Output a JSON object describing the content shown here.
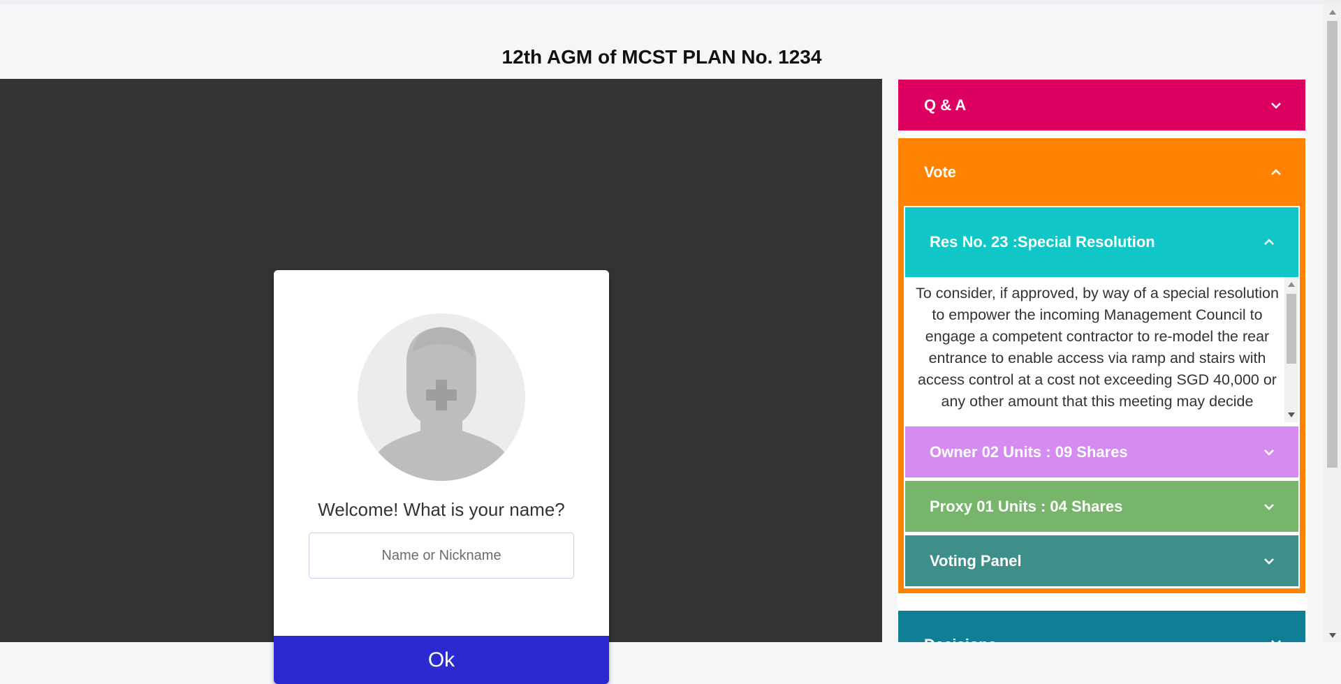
{
  "header": {
    "title": "12th AGM of MCST PLAN No. 1234"
  },
  "login_modal": {
    "welcome": "Welcome! What is your name?",
    "name_placeholder": "Name or Nickname",
    "ok_label": "Ok"
  },
  "sidebar": {
    "qa": {
      "label": "Q & A",
      "icon": "chevron-down-icon",
      "color": "#de0060"
    },
    "vote": {
      "label": "Vote",
      "icon": "chevron-up-icon",
      "color": "#ff8200",
      "resolution": {
        "label": "Res No. 23 :Special Resolution",
        "icon": "chevron-up-icon",
        "color": "#10c6c6",
        "text": "To consider, if approved, by way of a special resolution to empower the incoming Management Council to engage a competent contractor to re-model the rear entrance to enable access via ramp and stairs with access control at a cost not exceeding SGD 40,000 or any other amount that this meeting may decide"
      },
      "owner": {
        "label": "Owner 02 Units : 09 Shares",
        "icon": "chevron-down-icon",
        "color": "#d48cf0"
      },
      "proxy": {
        "label": "Proxy 01 Units : 04 Shares",
        "icon": "chevron-down-icon",
        "color": "#76b56a"
      },
      "voting_panel": {
        "label": "Voting Panel",
        "icon": "chevron-down-icon",
        "color": "#3e8f8a"
      }
    },
    "decisions": {
      "label": "Decisions",
      "icon": "chevron-down-icon",
      "color": "#0f7f95"
    }
  }
}
